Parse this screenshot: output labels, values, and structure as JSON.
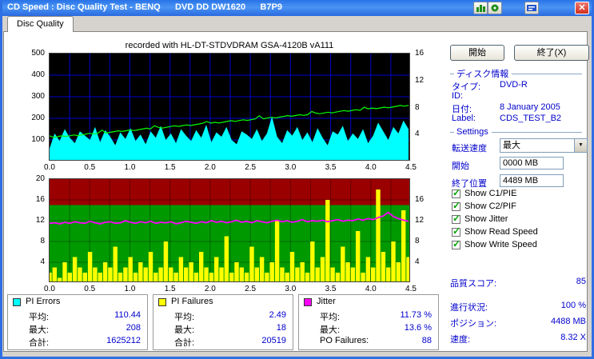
{
  "window": {
    "title": "CD Speed : Disc Quality Test - BENQ      DVD DD DW1620      B7P9"
  },
  "tabs": {
    "disc_quality": "Disc Quality"
  },
  "actions": {
    "start": "開始",
    "exit": "終了(X)"
  },
  "disc_info": {
    "title": "ディスク情報",
    "rows": [
      {
        "label": "タイプ:",
        "value": "DVD-R"
      },
      {
        "label": "ID:",
        "value": ""
      },
      {
        "label": "日付:",
        "value": "8 January 2005"
      },
      {
        "label": "Label:",
        "value": "CDS_TEST_B2"
      }
    ]
  },
  "settings": {
    "title": "Settings",
    "transfer_label": "転送速度",
    "transfer_value": "最大",
    "start_label": "開始",
    "start_value": "0000 MB",
    "end_label": "終了位置",
    "end_value": "4489 MB",
    "checkboxes": [
      {
        "label": "Show C1/PIE",
        "checked": true
      },
      {
        "label": "Show C2/PIF",
        "checked": true
      },
      {
        "label": "Show Jitter",
        "checked": true
      },
      {
        "label": "Show Read Speed",
        "checked": true
      },
      {
        "label": "Show Write Speed",
        "checked": true
      }
    ]
  },
  "quality_score": {
    "label": "品質スコア:",
    "value": "85"
  },
  "status": {
    "rows": [
      {
        "label": "進行状況:",
        "value": "100 %"
      },
      {
        "label": "ポジション:",
        "value": "4488 MB"
      },
      {
        "label": "速度:",
        "value": "8.32 X"
      }
    ]
  },
  "legends": [
    {
      "title": "PI Errors",
      "color": "#00ffff",
      "rows": [
        {
          "label": "平均:",
          "value": "110.44"
        },
        {
          "label": "最大:",
          "value": "208"
        },
        {
          "label": "合計:",
          "value": "1625212"
        }
      ]
    },
    {
      "title": "PI Failures",
      "color": "#ffff00",
      "rows": [
        {
          "label": "平均:",
          "value": "2.49"
        },
        {
          "label": "最大:",
          "value": "18"
        },
        {
          "label": "合計:",
          "value": "20519"
        }
      ]
    },
    {
      "title": "Jitter",
      "color": "#ff00ff",
      "rows": [
        {
          "label": "平均:",
          "value": "11.73 %"
        },
        {
          "label": "最大:",
          "value": "13.6 %"
        },
        {
          "label": "PO Failures:",
          "value": "88"
        }
      ]
    }
  ],
  "chart_data": [
    {
      "type": "area",
      "title": "recorded with HL-DT-STDVDRAM GSA-4120B vA111",
      "x_range": [
        0,
        4.5
      ],
      "x_ticks": [
        "0.0",
        "0.5",
        "1.0",
        "1.5",
        "2.0",
        "2.5",
        "3.0",
        "3.5",
        "4.0",
        "4.5"
      ],
      "y_left": {
        "range": [
          0,
          500
        ],
        "ticks": [
          500,
          400,
          300,
          200,
          100
        ]
      },
      "y_right": {
        "range": [
          0,
          16
        ],
        "ticks": [
          16,
          12,
          8,
          4
        ]
      },
      "bg": "#000000",
      "grid_color": "#0000cc",
      "series": [
        {
          "name": "PI Errors",
          "type": "area",
          "axis": "left",
          "color": "#00ffff",
          "values": [
            60,
            130,
            95,
            150,
            110,
            85,
            140,
            120,
            100,
            160,
            90,
            145,
            115,
            75,
            135,
            105,
            155,
            95,
            125,
            80,
            140,
            110,
            165,
            100,
            130,
            85,
            150,
            120,
            95,
            145,
            110,
            170,
            90,
            135,
            115,
            160,
            100,
            80,
            140,
            125,
            105,
            150,
            95,
            130,
            208,
            115,
            85,
            145,
            120,
            160,
            100,
            135,
            90,
            155,
            110,
            75,
            140,
            125,
            165,
            95,
            130,
            105,
            150,
            85,
            120,
            180,
            140,
            100,
            160,
            130,
            190,
            150
          ]
        },
        {
          "name": "Read Speed",
          "type": "line",
          "axis": "right",
          "color": "#00ff00",
          "start": 3.55,
          "end": 8.32
        }
      ]
    },
    {
      "type": "mixed",
      "x_range": [
        0,
        4.5
      ],
      "x_ticks": [
        "0.0",
        "0.5",
        "1.0",
        "1.5",
        "2.0",
        "2.5",
        "3.0",
        "3.5",
        "4.0",
        "4.5"
      ],
      "y_left": {
        "range": [
          0,
          20
        ],
        "ticks": [
          20,
          16,
          12,
          8,
          4
        ]
      },
      "y_right": {
        "range": [
          0,
          20
        ],
        "ticks": [
          16,
          12,
          8,
          4
        ]
      },
      "zones": [
        {
          "from": 15,
          "to": 20,
          "color": "#9b0000"
        },
        {
          "from": 0,
          "to": 15,
          "color": "#009a00"
        }
      ],
      "series": [
        {
          "name": "PI Failures",
          "type": "spikes",
          "axis": "left",
          "color": "#ffff00",
          "values": [
            2,
            3,
            1,
            4,
            2,
            5,
            3,
            2,
            6,
            3,
            2,
            4,
            3,
            7,
            2,
            3,
            5,
            2,
            4,
            3,
            6,
            2,
            3,
            8,
            3,
            2,
            5,
            3,
            4,
            2,
            6,
            3,
            2,
            5,
            3,
            9,
            2,
            4,
            3,
            2,
            7,
            3,
            5,
            2,
            4,
            12,
            3,
            2,
            6,
            3,
            4,
            2,
            8,
            3,
            5,
            16,
            3,
            2,
            7,
            4,
            3,
            10,
            2,
            5,
            3,
            18,
            6,
            3,
            8,
            4,
            14,
            5
          ]
        },
        {
          "name": "Jitter",
          "type": "line",
          "axis": "left",
          "unit": "%",
          "color": "#ff00ff",
          "values": [
            11.5,
            11.6,
            11.4,
            11.7,
            11.5,
            11.8,
            11.6,
            11.5,
            11.9,
            11.6,
            11.4,
            11.7,
            11.8,
            11.5,
            11.6,
            12.0,
            11.7,
            11.5,
            11.8,
            11.6,
            11.9,
            11.5,
            11.7,
            11.6,
            11.8,
            11.4,
            11.6,
            11.9,
            11.7,
            11.5,
            11.8,
            11.6,
            12.0,
            11.7,
            11.9,
            11.6,
            11.8,
            12.1,
            11.7,
            11.9,
            11.6,
            12.0,
            11.8,
            11.6,
            11.9,
            12.1,
            11.8,
            12.0,
            11.7,
            11.9,
            12.2,
            11.8,
            12.0,
            11.9,
            12.1,
            11.8,
            12.0,
            12.2,
            11.9,
            12.1,
            12.0,
            12.3,
            12.1,
            12.4,
            12.2,
            12.6,
            12.9,
            13.6,
            12.8,
            12.4,
            12.1,
            11.9
          ]
        }
      ]
    }
  ]
}
